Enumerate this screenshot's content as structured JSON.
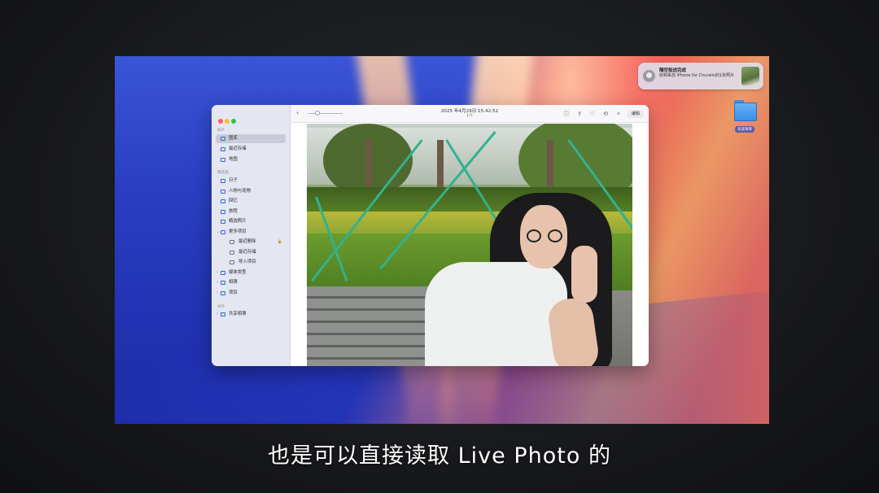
{
  "notification": {
    "title": "隔空投送完成",
    "body": "收到来自 iPhone for Churwin的1张照片"
  },
  "desktop_folder": {
    "label": "未读项目"
  },
  "photos_window": {
    "sidebar": {
      "section_photos": "照片",
      "section_collections": "精选集",
      "section_shared": "共享",
      "items": [
        {
          "label": "图库",
          "icon": "photo-library-icon",
          "selected": true
        },
        {
          "label": "最近存储",
          "icon": "clock-icon"
        },
        {
          "label": "地图",
          "icon": "map-icon"
        },
        {
          "label": "日子",
          "icon": "day-icon"
        },
        {
          "label": "人物与宠物",
          "icon": "people-icon"
        },
        {
          "label": "回忆",
          "icon": "memories-icon"
        },
        {
          "label": "旅程",
          "icon": "trip-icon"
        },
        {
          "label": "精选照片",
          "icon": "featured-icon"
        },
        {
          "label": "更多项目",
          "icon": "more-icon"
        },
        {
          "label": "最近删除",
          "icon": "trash-icon"
        },
        {
          "label": "最近存储",
          "icon": "recent-icon"
        },
        {
          "label": "导入项目",
          "icon": "import-icon"
        },
        {
          "label": "媒体类型",
          "icon": "media-types-icon"
        },
        {
          "label": "相簿",
          "icon": "albums-icon"
        },
        {
          "label": "项目",
          "icon": "projects-icon"
        },
        {
          "label": "共享相簿",
          "icon": "shared-albums-icon"
        }
      ]
    },
    "toolbar": {
      "date": "2025 年4月29日 15:42:52",
      "count": "1/1",
      "edit_label": "编辑",
      "icons": [
        "info-icon",
        "share-icon",
        "heart-icon",
        "rotate-icon",
        "enhance-icon"
      ]
    }
  },
  "subtitle": "也是可以直接读取 Live Photo 的",
  "colors": {
    "accent": "#2f66d0",
    "sidebar_bg": "#e4e6f1",
    "selection": "#c9cbd8"
  }
}
